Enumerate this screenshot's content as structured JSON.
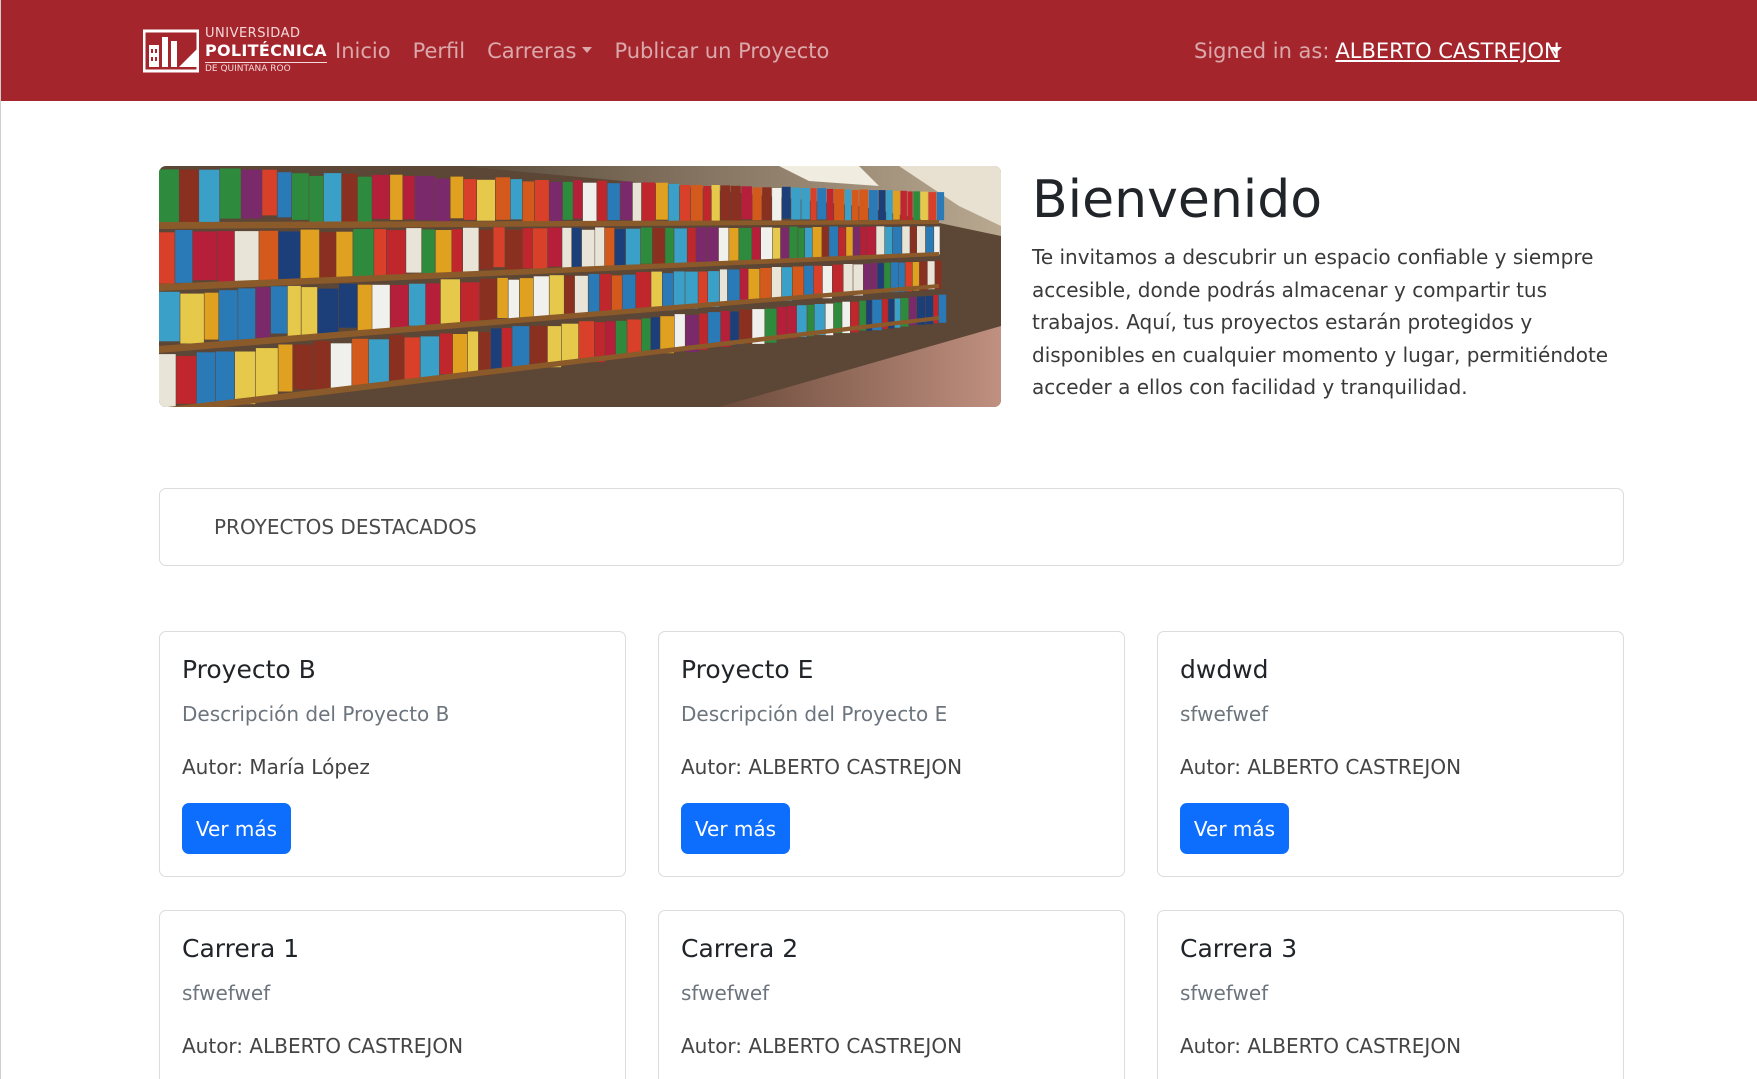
{
  "navbar": {
    "logo": {
      "line1": "UNIVERSIDAD",
      "line2": "POLITÉCNICA",
      "line3": "DE QUINTANA ROO"
    },
    "links": [
      {
        "label": "Inicio"
      },
      {
        "label": "Perfil"
      },
      {
        "label": "Carreras",
        "dropdown": true
      },
      {
        "label": "Publicar un Proyecto"
      }
    ],
    "signed_in_prefix": "Signed in as:",
    "user_name": "ALBERTO CASTREJON",
    "colors": {
      "background": "#a4262c"
    }
  },
  "hero": {
    "title": "Bienvenido",
    "text": "Te invitamos a descubrir un espacio confiable y siempre accesible, donde podrás almacenar y compartir tus trabajos. Aquí, tus proyectos estarán protegidos y disponibles en cualquier momento y lugar, permitiéndote acceder a ellos con facilidad y tranquilidad.",
    "image": "library-bookshelves-image"
  },
  "featured": {
    "label": "PROYECTOS DESTACADOS"
  },
  "cards": [
    {
      "title": "Proyecto B",
      "description": "Descripción del Proyecto B",
      "author": "Autor: María López",
      "button": "Ver más"
    },
    {
      "title": "Proyecto E",
      "description": "Descripción del Proyecto E",
      "author": "Autor: ALBERTO CASTREJON",
      "button": "Ver más"
    },
    {
      "title": "dwdwd",
      "description": "sfwefwef",
      "author": "Autor: ALBERTO CASTREJON",
      "button": "Ver más"
    },
    {
      "title": "Carrera 1",
      "description": "sfwefwef",
      "author": "Autor: ALBERTO CASTREJON"
    },
    {
      "title": "Carrera 2",
      "description": "sfwefwef",
      "author": "Autor: ALBERTO CASTREJON"
    },
    {
      "title": "Carrera 3",
      "description": "sfwefwef",
      "author": "Autor: ALBERTO CASTREJON"
    }
  ],
  "colors": {
    "primary_button": "#0d6efd",
    "card_border": "#dcdcdc"
  }
}
